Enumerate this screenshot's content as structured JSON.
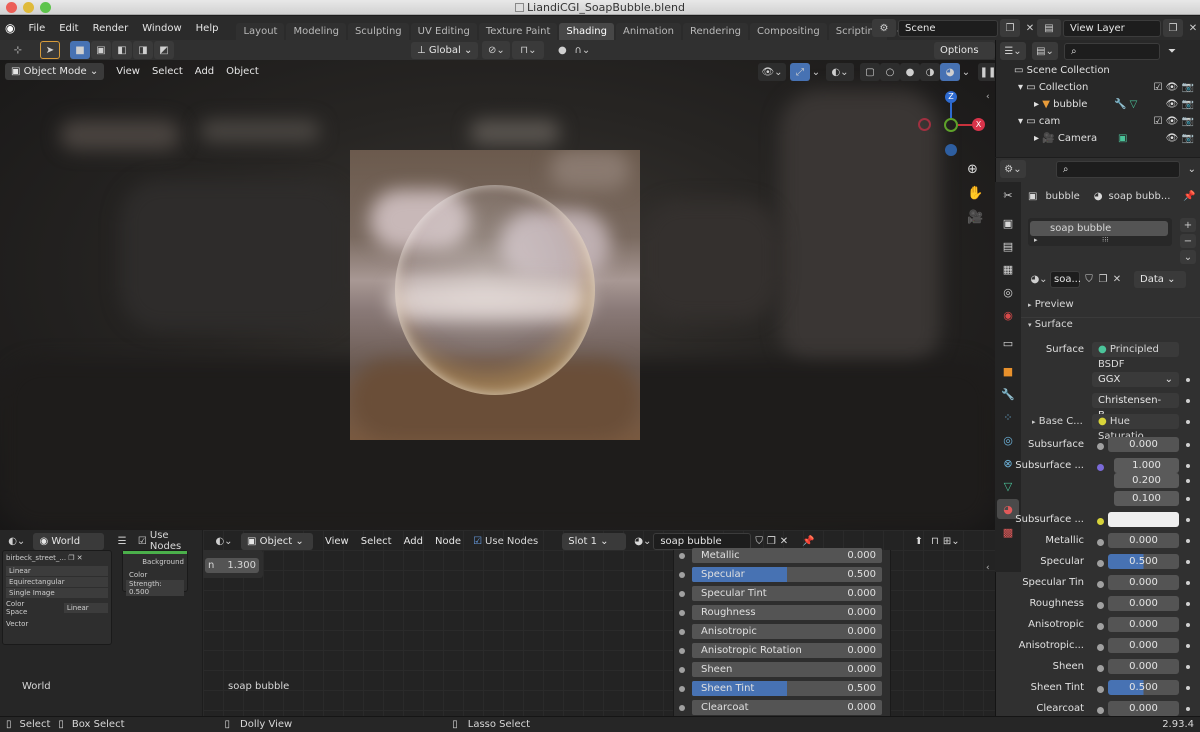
{
  "window": {
    "title": "LiandiCGI_SoapBubble.blend"
  },
  "menu": [
    "File",
    "Edit",
    "Render",
    "Window",
    "Help"
  ],
  "workspaces": [
    "Layout",
    "Modeling",
    "Sculpting",
    "UV Editing",
    "Texture Paint",
    "Shading",
    "Animation",
    "Rendering",
    "Compositing",
    "Scripting"
  ],
  "active_workspace": "Shading",
  "scene": "Scene",
  "view_layer": "View Layer",
  "toolbar": {
    "transform_orientation": "Global",
    "options": "Options"
  },
  "viewport_header": {
    "mode": "Object Mode",
    "view": "View",
    "select": "Select",
    "add": "Add",
    "object": "Object"
  },
  "gizmo": {
    "z": "Z",
    "x": "X",
    "y": "Y"
  },
  "outliner": {
    "rows": [
      {
        "label": "Scene Collection"
      },
      {
        "label": "Collection"
      },
      {
        "label": "bubble"
      },
      {
        "label": "cam"
      },
      {
        "label": "Camera"
      }
    ]
  },
  "properties": {
    "object": "bubble",
    "material_header": "soap bubb...",
    "slot_name": "soap bubble",
    "mat_short": "soa...",
    "data_select": "Data",
    "preview": "Preview",
    "surface_panel": "Surface",
    "surface_label": "Surface",
    "surface_value": "Principled BSDF",
    "distribution": "GGX",
    "subsurface_method": "Christensen-B...",
    "base_color_label": "Base C...",
    "base_color_value": "Hue Saturatio...",
    "rows": [
      {
        "label": "Subsurface",
        "value": "0.000"
      },
      {
        "label": "Subsurface ...",
        "value": "1.000"
      },
      {
        "label": "",
        "value": "0.200"
      },
      {
        "label": "",
        "value": "0.100"
      },
      {
        "label": "Subsurface ...",
        "value": ""
      },
      {
        "label": "Metallic",
        "value": "0.000"
      },
      {
        "label": "Specular",
        "value": "0.500"
      },
      {
        "label": "Specular Tin",
        "value": "0.000"
      },
      {
        "label": "Roughness",
        "value": "0.000"
      },
      {
        "label": "Anisotropic",
        "value": "0.000"
      },
      {
        "label": "Anisotropic...",
        "value": "0.000"
      },
      {
        "label": "Sheen",
        "value": "0.000"
      },
      {
        "label": "Sheen Tint",
        "value": "0.500"
      },
      {
        "label": "Clearcoat",
        "value": "0.000"
      }
    ]
  },
  "world_editor": {
    "shader_type": "World",
    "use_nodes": "Use Nodes",
    "label": "World",
    "image": "birbeck_street_...",
    "interp": "Linear",
    "proj": "Equirectangular",
    "source": "Single Image",
    "color_space_label": "Color Space",
    "color_space": "Linear",
    "vector": "Vector",
    "bg_node_out": "Background",
    "bg_color": "Color",
    "bg_strength": "Strength: 0.500"
  },
  "shader_editor": {
    "object": "Object",
    "view": "View",
    "select": "Select",
    "add": "Add",
    "node": "Node",
    "use_nodes": "Use Nodes",
    "slot": "Slot 1",
    "material": "soap bubble",
    "ior_suffix": "n",
    "ior_value": "1.300",
    "label": "soap bubble",
    "rows": [
      {
        "label": "Metallic",
        "value": "0.000",
        "fill": 0
      },
      {
        "label": "Specular",
        "value": "0.500",
        "fill": 0.5
      },
      {
        "label": "Specular Tint",
        "value": "0.000",
        "fill": 0
      },
      {
        "label": "Roughness",
        "value": "0.000",
        "fill": 0
      },
      {
        "label": "Anisotropic",
        "value": "0.000",
        "fill": 0
      },
      {
        "label": "Anisotropic Rotation",
        "value": "0.000",
        "fill": 0
      },
      {
        "label": "Sheen",
        "value": "0.000",
        "fill": 0
      },
      {
        "label": "Sheen Tint",
        "value": "0.500",
        "fill": 0.5
      },
      {
        "label": "Clearcoat",
        "value": "0.000",
        "fill": 0
      }
    ]
  },
  "status": {
    "select": "Select",
    "box_select": "Box Select",
    "dolly": "Dolly View",
    "lasso": "Lasso Select",
    "version": "2.93.4"
  }
}
